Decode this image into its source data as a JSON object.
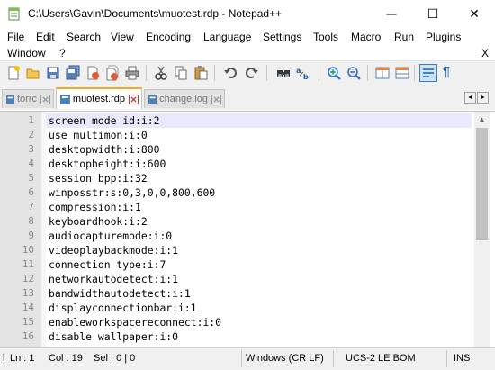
{
  "window": {
    "title": "C:\\Users\\Gavin\\Documents\\muotest.rdp - Notepad++",
    "minimize_glyph": "—",
    "maximize_glyph": "☐",
    "close_glyph": "✕"
  },
  "menu": {
    "items": [
      "File",
      "Edit",
      "Search",
      "View",
      "Encoding",
      "Language",
      "Settings",
      "Tools",
      "Macro",
      "Run",
      "Plugins",
      "Window",
      "?"
    ],
    "close_doc": "X"
  },
  "tabs": [
    {
      "label": "torrc",
      "active": false
    },
    {
      "label": "muotest.rdp",
      "active": true
    },
    {
      "label": "change.log",
      "active": false
    }
  ],
  "tab_nav": {
    "left": "◄",
    "right": "►"
  },
  "editor": {
    "lines": [
      {
        "n": "1",
        "text": "screen mode id:i:2"
      },
      {
        "n": "2",
        "text": "use multimon:i:0"
      },
      {
        "n": "3",
        "text": "desktopwidth:i:800"
      },
      {
        "n": "4",
        "text": "desktopheight:i:600"
      },
      {
        "n": "5",
        "text": "session bpp:i:32"
      },
      {
        "n": "6",
        "text": "winposstr:s:0,3,0,0,800,600"
      },
      {
        "n": "7",
        "text": "compression:i:1"
      },
      {
        "n": "8",
        "text": "keyboardhook:i:2"
      },
      {
        "n": "9",
        "text": "audiocapturemode:i:0"
      },
      {
        "n": "10",
        "text": "videoplaybackmode:i:1"
      },
      {
        "n": "11",
        "text": "connection type:i:7"
      },
      {
        "n": "12",
        "text": "networkautodetect:i:1"
      },
      {
        "n": "13",
        "text": "bandwidthautodetect:i:1"
      },
      {
        "n": "14",
        "text": "displayconnectionbar:i:1"
      },
      {
        "n": "15",
        "text": "enableworkspacereconnect:i:0"
      },
      {
        "n": "16",
        "text": "disable wallpaper:i:0"
      }
    ],
    "scroll_up": "▲"
  },
  "status": {
    "length_prefix": "l",
    "ln": "Ln : 1",
    "col": "Col : 19",
    "sel": "Sel : 0 | 0",
    "eol": "Windows (CR LF)",
    "encoding": "UCS-2 LE BOM",
    "mode": "INS"
  },
  "colors": {
    "active_tab_accent": "#f5a623",
    "current_line": "#e8e8ff",
    "gutter": "#e4e4e4"
  }
}
